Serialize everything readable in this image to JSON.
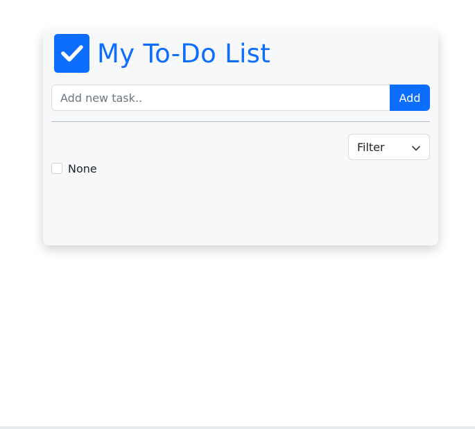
{
  "header": {
    "title": "My To-Do List",
    "icon": "check-box-icon"
  },
  "task_input": {
    "placeholder": "Add new task..",
    "value": ""
  },
  "add_button": {
    "label": "Add"
  },
  "filter": {
    "selected": "Filter",
    "icon": "chevron-down-icon"
  },
  "tasks": [
    {
      "label": "None",
      "checked": false
    }
  ],
  "colors": {
    "accent": "#0d6efd",
    "card_background": "#f7f8fa",
    "page_background": "#ffffff"
  }
}
